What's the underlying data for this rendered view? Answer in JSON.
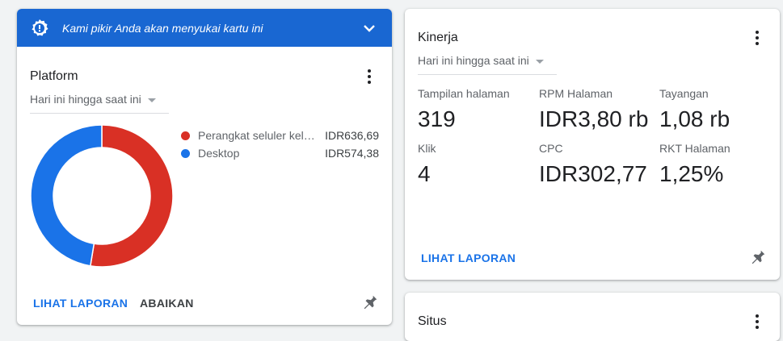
{
  "platform_card": {
    "banner_text": "Kami pikir Anda akan menyukai kartu ini",
    "title": "Platform",
    "range": "Hari ini hingga saat ini",
    "legend": [
      {
        "name": "Perangkat seluler kela…",
        "value": "IDR636,69",
        "color": "#d93025"
      },
      {
        "name": "Desktop",
        "value": "IDR574,38",
        "color": "#1a73e8"
      }
    ],
    "report_action": "LIHAT LAPORAN",
    "dismiss_action": "ABAIKAN"
  },
  "chart_data": {
    "type": "pie",
    "style": "donut",
    "categories": [
      "Perangkat seluler kela…",
      "Desktop"
    ],
    "values": [
      636.69,
      574.38
    ],
    "colors": [
      "#d93025",
      "#1a73e8"
    ],
    "title": ""
  },
  "kinerja_card": {
    "title": "Kinerja",
    "range": "Hari ini hingga saat ini",
    "metrics": [
      {
        "label": "Tampilan halaman",
        "value": "319"
      },
      {
        "label": "RPM Halaman",
        "value": "IDR3,80 rb"
      },
      {
        "label": "Tayangan",
        "value": "1,08 rb"
      },
      {
        "label": "Klik",
        "value": "4"
      },
      {
        "label": "CPC",
        "value": "IDR302,77"
      },
      {
        "label": "RKT Halaman",
        "value": "1,25%"
      }
    ],
    "report_action": "LIHAT LAPORAN"
  },
  "situs_card": {
    "title": "Situs"
  },
  "icons": {
    "banner": "lightbulb-badge-icon",
    "expand": "chevron-down-icon",
    "menu": "more-vert-icon",
    "pin": "pin-icon"
  }
}
